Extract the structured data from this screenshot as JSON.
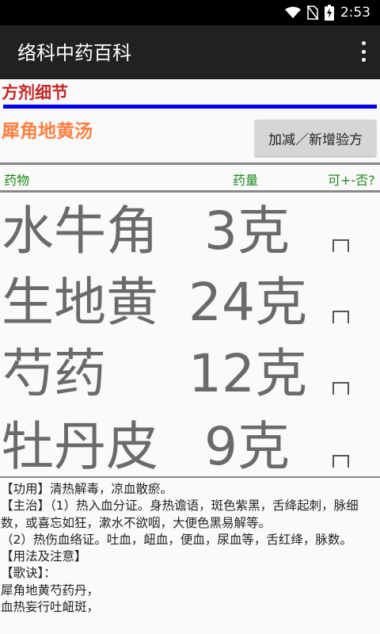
{
  "status_bar": {
    "time": "2:53"
  },
  "app_bar": {
    "title": "络科中药百科"
  },
  "section_title": "方剂细节",
  "formula_name": "犀角地黄汤",
  "modify_button": "加减／新增验方",
  "columns": {
    "herb": "药物",
    "dose": "药量",
    "optional": "可+-否?"
  },
  "herbs": [
    {
      "name": "水牛角",
      "dose": "3克"
    },
    {
      "name": "生地黄",
      "dose": "24克"
    },
    {
      "name": "芍药",
      "dose": "12克"
    },
    {
      "name": "牡丹皮",
      "dose": "9克"
    }
  ],
  "description": [
    "【功用】清热解毒，凉血散瘀。",
    "【主治】（1）热入血分证。身热谵语，斑色紫黑，舌绛起刺，脉细数，或喜忘如狂，漱水不欲咽，大便色黑易解等。",
    "（2）热伤血络证。吐血，衄血，便血，尿血等，舌红绛，脉数。",
    "【用法及注意】",
    "【歌诀】：",
    "犀角地黄芍药丹，",
    "血热妄行吐衄斑，"
  ]
}
